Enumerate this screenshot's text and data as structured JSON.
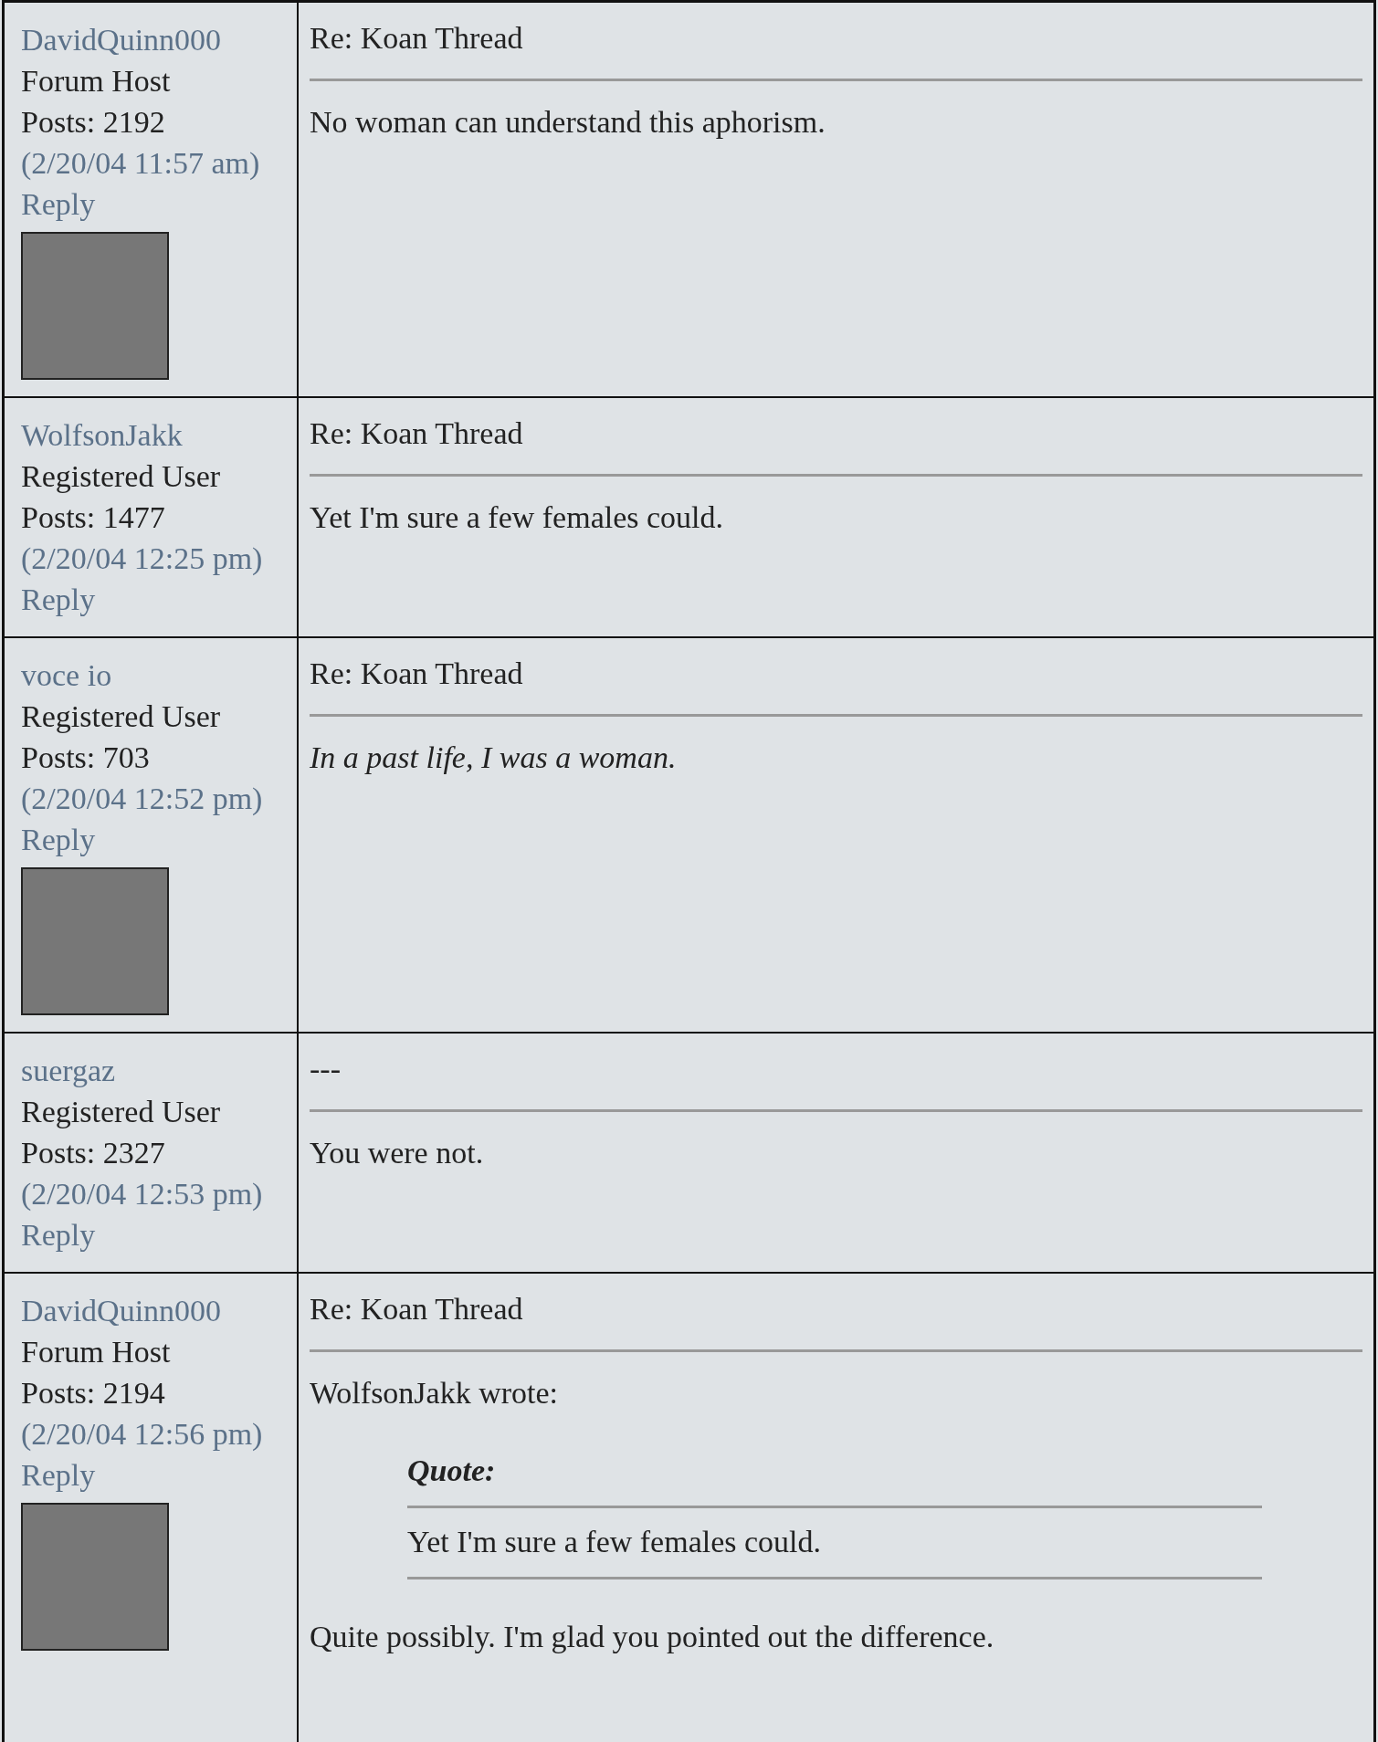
{
  "posts": [
    {
      "author": "DavidQuinn000",
      "rank": "Forum Host",
      "post_count": "Posts: 2192",
      "date": "(2/20/04 11:57 am)",
      "reply": "Reply",
      "avatar": true,
      "subject": "Re: Koan Thread",
      "body": [
        {
          "kind": "text",
          "text": "No woman can understand this aphorism."
        }
      ]
    },
    {
      "author": "WolfsonJakk",
      "rank": "Registered User",
      "post_count": "Posts: 1477",
      "date": "(2/20/04 12:25 pm)",
      "reply": "Reply",
      "avatar": false,
      "subject": "Re: Koan Thread",
      "body": [
        {
          "kind": "text",
          "text": "Yet I'm sure a few females could."
        }
      ]
    },
    {
      "author": "voce io",
      "rank": "Registered User",
      "post_count": "Posts: 703",
      "date": "(2/20/04 12:52 pm)",
      "reply": "Reply",
      "avatar": true,
      "subject": "Re: Koan Thread",
      "body": [
        {
          "kind": "italic",
          "text": "In a past life, I was a woman."
        }
      ]
    },
    {
      "author": "suergaz",
      "rank": "Registered User",
      "post_count": "Posts: 2327",
      "date": "(2/20/04 12:53 pm)",
      "reply": "Reply",
      "avatar": false,
      "subject": "---",
      "body": [
        {
          "kind": "text",
          "text": "You were not."
        }
      ]
    },
    {
      "author": "DavidQuinn000",
      "rank": "Forum Host",
      "post_count": "Posts: 2194",
      "date": "(2/20/04 12:56 pm)",
      "reply": "Reply",
      "avatar": true,
      "subject": "Re: Koan Thread",
      "body": [
        {
          "kind": "text",
          "text": "WolfsonJakk wrote:"
        },
        {
          "kind": "quote",
          "label": "Quote:",
          "text": "Yet I'm sure a few females could."
        },
        {
          "kind": "text",
          "text": "Quite possibly. I'm glad you pointed out the difference."
        }
      ]
    }
  ]
}
